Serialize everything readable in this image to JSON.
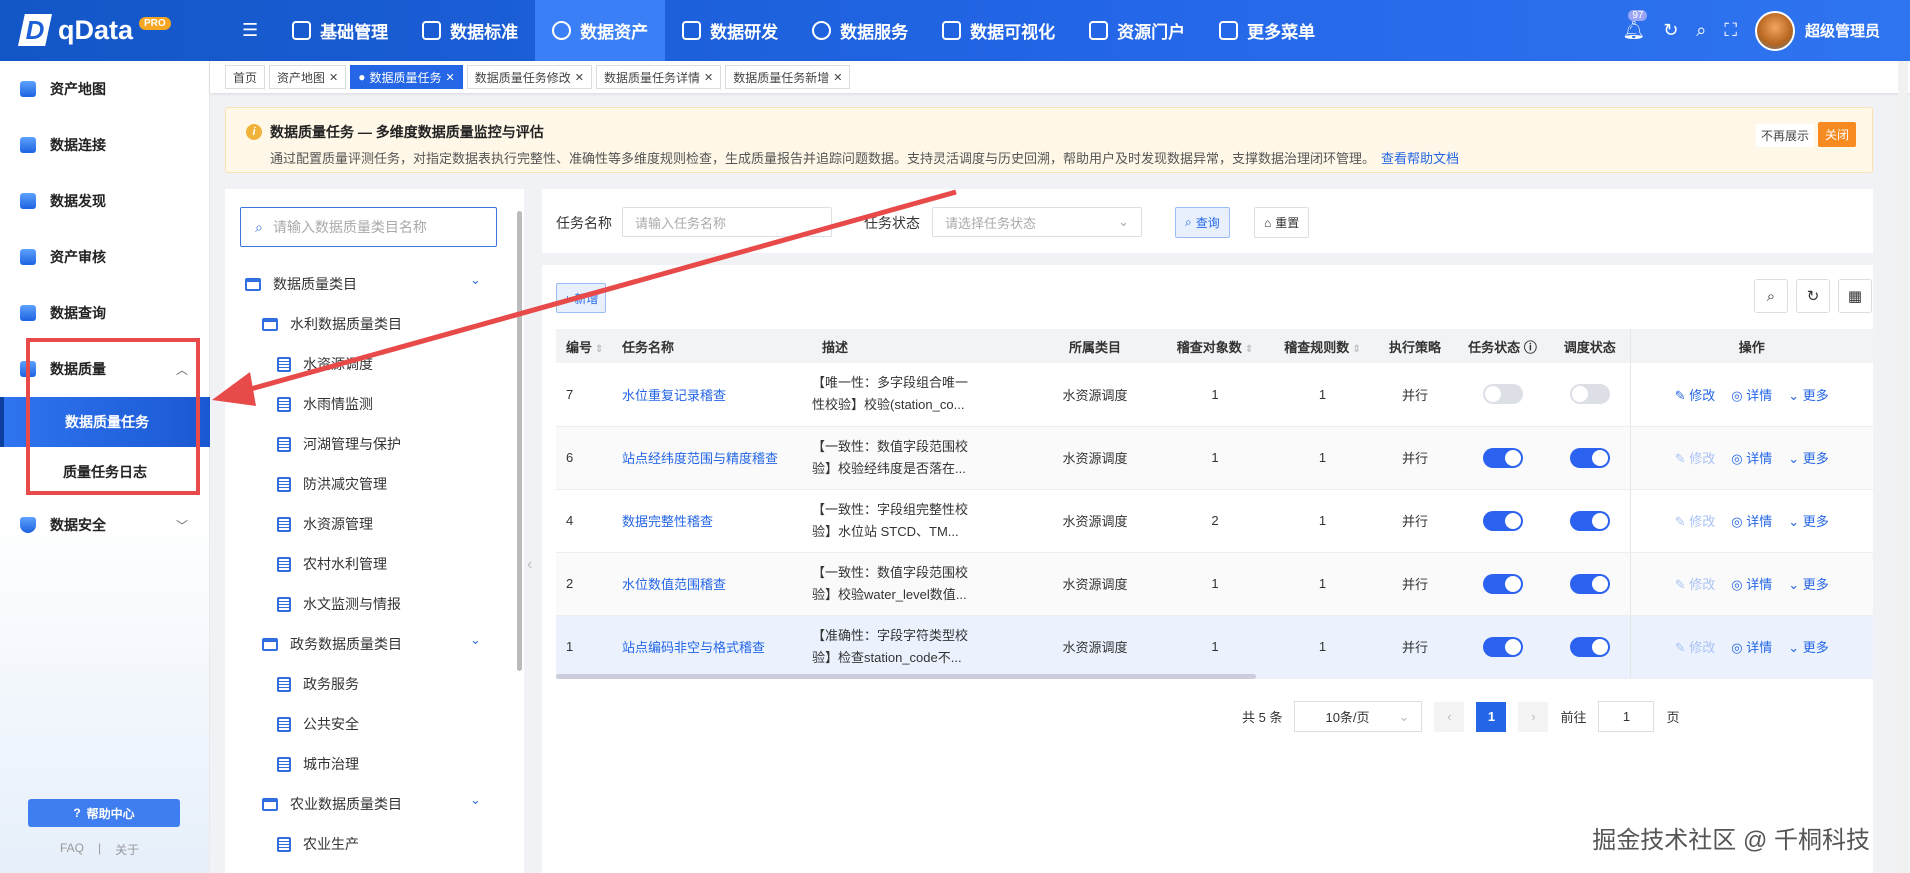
{
  "app": {
    "logo": "qData",
    "badge": "PRO",
    "user": "超级管理员",
    "notif_count": "97"
  },
  "nav": [
    "基础管理",
    "数据标准",
    "数据资产",
    "数据研发",
    "数据服务",
    "数据可视化",
    "资源门户",
    "更多菜单"
  ],
  "sidebar": {
    "items": [
      "资产地图",
      "数据连接",
      "数据发现",
      "资产审核",
      "数据查询",
      "数据质量"
    ],
    "sub": [
      "数据质量任务",
      "质量任务日志"
    ],
    "after": "数据安全",
    "help": "帮助中心",
    "faq": "FAQ",
    "sep": "|",
    "about": "关于"
  },
  "tabs": [
    "首页",
    "资产地图",
    "数据质量任务",
    "数据质量任务修改",
    "数据质量任务详情",
    "数据质量任务新增"
  ],
  "notice": {
    "title": "数据质量任务 — 多维度数据质量监控与评估",
    "desc": "通过配置质量评测任务，对指定数据表执行完整性、准确性等多维度规则检查，生成质量报告并追踪问题数据。支持灵活调度与历史回溯，帮助用户及时发现数据异常，支撑数据治理闭环管理。",
    "link": "查看帮助文档",
    "no_show": "不再展示",
    "close": "关闭"
  },
  "tree": {
    "placeholder": "请输入数据质量类目名称",
    "nodes": [
      {
        "label": "数据质量类目",
        "type": "root"
      },
      {
        "label": "水利数据质量类目",
        "type": "folder"
      },
      {
        "label": "水资源调度",
        "type": "leaf"
      },
      {
        "label": "水雨情监测",
        "type": "leaf"
      },
      {
        "label": "河湖管理与保护",
        "type": "leaf"
      },
      {
        "label": "防洪减灾管理",
        "type": "leaf"
      },
      {
        "label": "水资源管理",
        "type": "leaf"
      },
      {
        "label": "农村水利管理",
        "type": "leaf"
      },
      {
        "label": "水文监测与情报",
        "type": "leaf"
      },
      {
        "label": "政务数据质量类目",
        "type": "folder"
      },
      {
        "label": "政务服务",
        "type": "leaf"
      },
      {
        "label": "公共安全",
        "type": "leaf"
      },
      {
        "label": "城市治理",
        "type": "leaf"
      },
      {
        "label": "农业数据质量类目",
        "type": "folder"
      },
      {
        "label": "农业生产",
        "type": "leaf"
      }
    ]
  },
  "filter": {
    "name_label": "任务名称",
    "name_placeholder": "请输入任务名称",
    "status_label": "任务状态",
    "status_placeholder": "请选择任务状态",
    "query": "查询",
    "reset": "重置"
  },
  "table": {
    "add": "+ 新增",
    "columns": [
      "编号",
      "任务名称",
      "描述",
      "所属类目",
      "稽查对象数",
      "稽查规则数",
      "执行策略",
      "任务状态",
      "调度状态",
      "操作"
    ],
    "rows": [
      {
        "id": "7",
        "name": "水位重复记录稽查",
        "desc1": "【唯一性：多字段组合唯一",
        "desc2": "性校验】校验(station_co...",
        "cat": "水资源调度",
        "objs": "1",
        "rules": "1",
        "strategy": "并行",
        "task_on": false,
        "sched_on": false
      },
      {
        "id": "6",
        "name": "站点经纬度范围与精度稽查",
        "desc1": "【一致性：数值字段范围校",
        "desc2": "验】校验经纬度是否落在...",
        "cat": "水资源调度",
        "objs": "1",
        "rules": "1",
        "strategy": "并行",
        "task_on": true,
        "sched_on": true
      },
      {
        "id": "4",
        "name": "数据完整性稽查",
        "desc1": "【一致性：字段组完整性校",
        "desc2": "验】水位站 STCD、TM...",
        "cat": "水资源调度",
        "objs": "2",
        "rules": "1",
        "strategy": "并行",
        "task_on": true,
        "sched_on": true
      },
      {
        "id": "2",
        "name": "水位数值范围稽查",
        "desc1": "【一致性：数值字段范围校",
        "desc2": "验】校验water_level数值...",
        "cat": "水资源调度",
        "objs": "1",
        "rules": "1",
        "strategy": "并行",
        "task_on": true,
        "sched_on": true
      },
      {
        "id": "1",
        "name": "站点编码非空与格式稽查",
        "desc1": "【准确性：字段字符类型校",
        "desc2": "验】检查station_code不...",
        "cat": "水资源调度",
        "objs": "1",
        "rules": "1",
        "strategy": "并行",
        "task_on": true,
        "sched_on": true
      }
    ],
    "ops": {
      "edit": "修改",
      "detail": "详情",
      "more": "更多"
    }
  },
  "pager": {
    "total": "共 5 条",
    "size": "10条/页",
    "page": "1",
    "goto": "前往",
    "goto_val": "1",
    "unit": "页"
  },
  "watermark": "掘金技术社区 @ 千桐科技",
  "colors": {
    "primary": "#2466e6",
    "annotation": "#e84a4a",
    "warning": "#f78a21"
  }
}
